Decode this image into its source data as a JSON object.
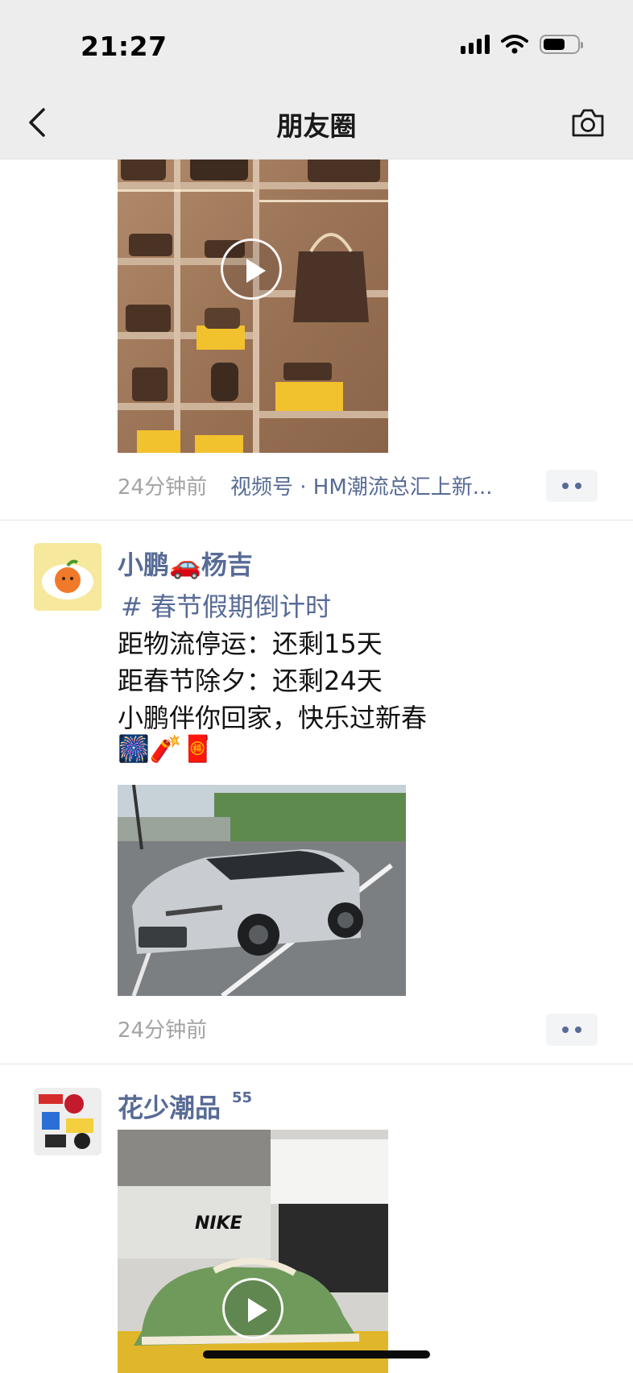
{
  "status_bar": {
    "time": "21:27"
  },
  "nav": {
    "title": "朋友圈"
  },
  "feed": {
    "post1": {
      "time": "24分钟前",
      "channel_link": "视频号 · HM潮流总汇上新..."
    },
    "post2": {
      "username": "小鹏🚗杨吉",
      "hashtag": "# 春节假期倒计时",
      "lines": [
        "距物流停运：还剩15天",
        "距春节除夕：还剩24天",
        "小鹏伴你回家，快乐过新春"
      ],
      "emoji_line": "🎆🧨🧧",
      "time": "24分钟前"
    },
    "post3": {
      "username": "花少潮品",
      "username_badge": "55",
      "brand_text": "NIKE"
    }
  },
  "colors": {
    "link": "#576b95",
    "time_gray": "#a3a3a3",
    "nav_bg": "#ededed"
  },
  "icons": {
    "back": "chevron-left-icon",
    "camera": "camera-icon",
    "play": "play-icon"
  }
}
